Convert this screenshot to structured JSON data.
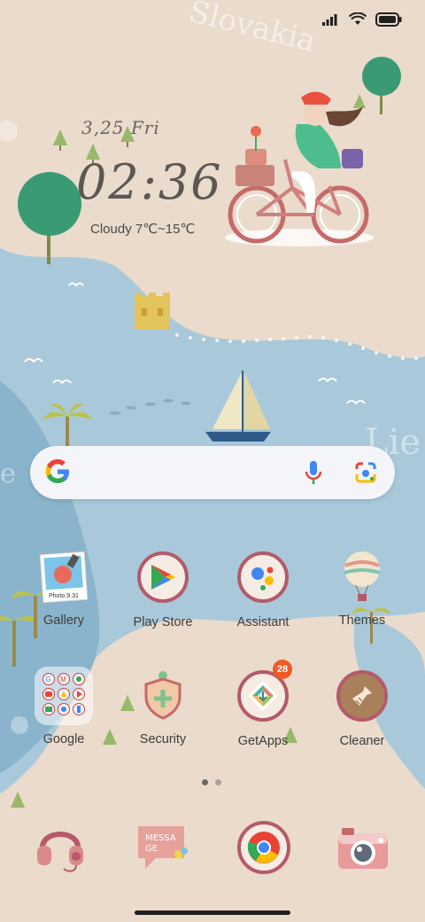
{
  "wallpaper": {
    "country_text": "Slovakia",
    "colors": {
      "sand": "#eadbcc",
      "sea": "#a9c9da",
      "deep_sea": "#8ab4cc",
      "tree": "#3a9a74"
    }
  },
  "status_bar": {
    "icons": [
      "signal-icon",
      "wifi-icon",
      "battery-icon"
    ]
  },
  "clock_widget": {
    "date": "3,25 Fri",
    "time": "02:36",
    "weather": "Cloudy 7℃~15℃"
  },
  "search_bar": {
    "icons": [
      "google-g-icon",
      "microphone-icon",
      "lens-icon"
    ]
  },
  "apps": {
    "row1": [
      {
        "label": "Gallery",
        "icon": "gallery-icon"
      },
      {
        "label": "Play Store",
        "icon": "play-store-icon"
      },
      {
        "label": "Assistant",
        "icon": "assistant-icon"
      },
      {
        "label": "Themes",
        "icon": "themes-balloon-icon"
      }
    ],
    "row2": [
      {
        "label": "Google",
        "icon": "google-folder-icon"
      },
      {
        "label": "Security",
        "icon": "security-shield-icon"
      },
      {
        "label": "GetApps",
        "icon": "getapps-icon",
        "badge": "28"
      },
      {
        "label": "Cleaner",
        "icon": "cleaner-brush-icon"
      }
    ]
  },
  "gallery_photo_caption": "Photo.9.31",
  "page_indicator": {
    "pages": 2,
    "current": 1
  },
  "dock": [
    {
      "name": "headphones-icon"
    },
    {
      "name": "message-icon",
      "text": "MESSA GE"
    },
    {
      "name": "chrome-icon"
    },
    {
      "name": "camera-icon"
    }
  ],
  "accent": {
    "badge": "#ee5a24",
    "ring": "#b45a6a"
  }
}
